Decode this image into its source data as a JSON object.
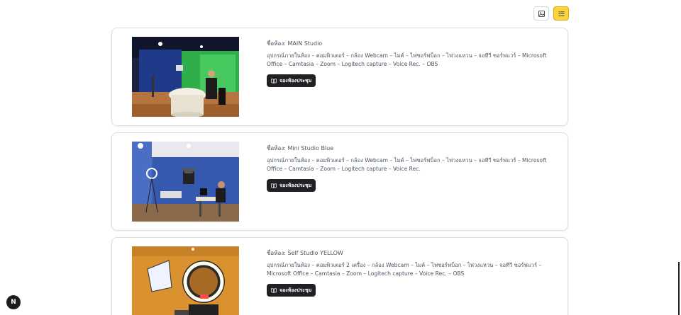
{
  "toolbar": {
    "grid_icon": "image-icon",
    "list_icon": "list-icon",
    "active_view": "list"
  },
  "rooms": [
    {
      "name": "ชื่อห้อง: MAIN Studio",
      "equipment": "อุปกรณ์ภายในห้อง – คอมพิวเตอร์ – กล้อง Webcam – ไมค์ – ไฟซอร์ฟบ็อก – ไฟวงแหวน – จอทีวี ซอร์ฟแวร์ – Microsoft Office – Camtasia – Zoom – Logitech capture – Voice Rec. – OBS",
      "book_label": "จองห้องประชุม"
    },
    {
      "name": "ชื่อห้อง: Mini Studio Blue",
      "equipment": "อุปกรณ์ภายในห้อง – คอมพิวเตอร์ – กล้อง Webcam – ไมค์ – ไฟซอร์ฟบ็อก – ไฟวงแหวน – จอทีวี ซอร์ฟแวร์ – Microsoft Office – Camtasia – Zoom – Logitech capture – Voice Rec.",
      "book_label": "จองห้องประชุม"
    },
    {
      "name": "ชื่อห้อง: Self Studio YELLOW",
      "equipment": "อุปกรณ์ภายในห้อง – คอมพิวเตอร์ 2 เครื่อง – กล้อง Webcam – ไมค์ – ไฟซอร์ฟบ็อก – ไฟวงแหวน – จอทีวี ซอร์ฟแวร์ – Microsoft Office – Camtasia – Zoom – Logitech capture – Voice Rec. – OBS",
      "book_label": "จองห้องประชุม"
    }
  ],
  "fab": {
    "label": "N"
  },
  "colors": {
    "accent": "#fbd33c",
    "button_dark": "#1f2125"
  }
}
